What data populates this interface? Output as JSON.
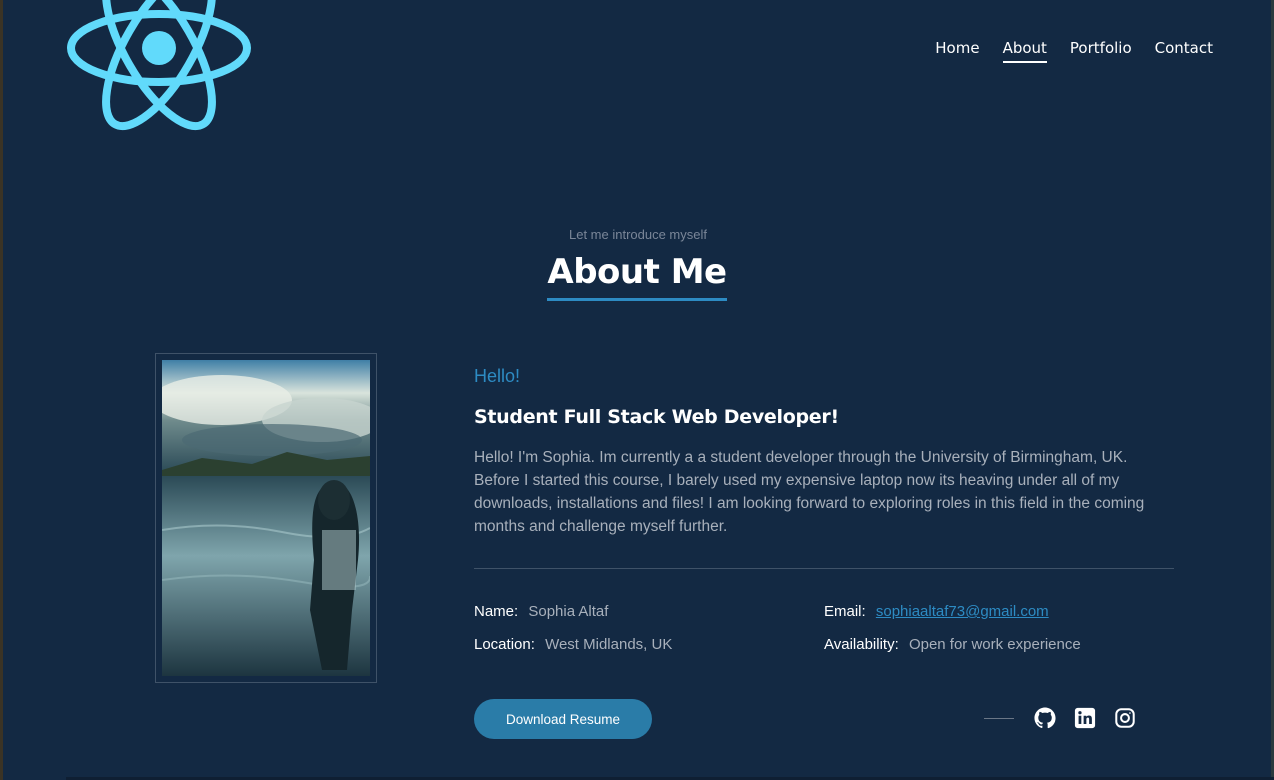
{
  "nav": {
    "items": [
      {
        "label": "Home",
        "active": false
      },
      {
        "label": "About",
        "active": true
      },
      {
        "label": "Portfolio",
        "active": false
      },
      {
        "label": "Contact",
        "active": false
      }
    ]
  },
  "section": {
    "subtitle": "Let me introduce myself",
    "title": "About Me"
  },
  "about": {
    "greeting": "Hello!",
    "role": "Student Full Stack Web Developer!",
    "bio": "Hello! I'm Sophia. Im currently a a student developer through the University of Birmingham, UK. Before I started this course, I barely used my expensive laptop now its heaving under all of my downloads, installations and files! I am looking forward to exploring roles in this field in the coming months and challenge myself further.",
    "details": {
      "name_label": "Name:",
      "name_value": "Sophia Altaf",
      "email_label": "Email:",
      "email_value": "sophiaaltaf73@gmail.com",
      "location_label": "Location:",
      "location_value": "West Midlands, UK",
      "availability_label": "Availability:",
      "availability_value": "Open for work experience"
    },
    "resume_button": "Download Resume"
  },
  "socials": [
    "github-icon",
    "linkedin-icon",
    "instagram-icon"
  ],
  "colors": {
    "background": "#132943",
    "accent": "#2d8bc3",
    "logo": "#61dafb",
    "muted_text": "#a8b0bb"
  }
}
